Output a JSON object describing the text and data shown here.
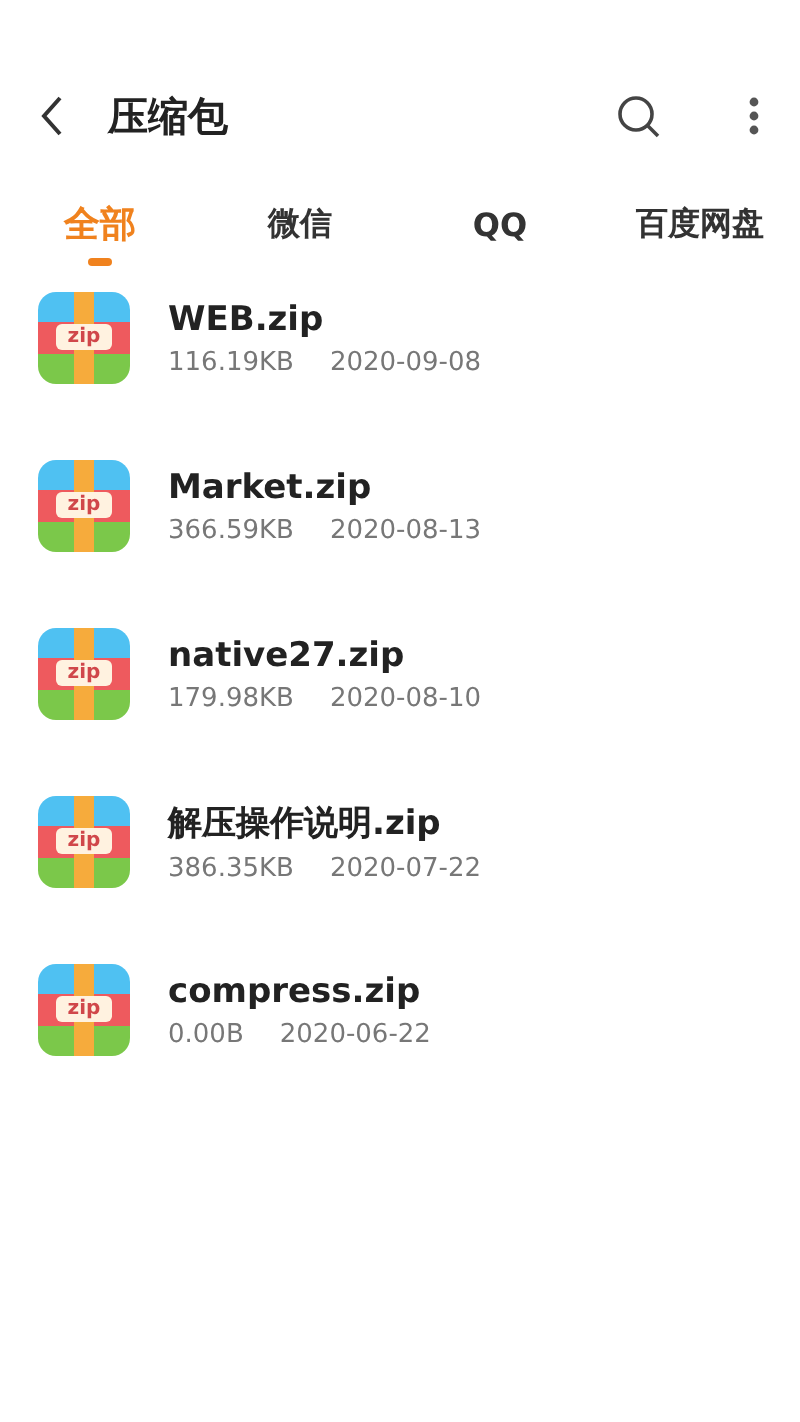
{
  "header": {
    "title": "压缩包"
  },
  "tabs": [
    {
      "label": "全部",
      "selected": true
    },
    {
      "label": "微信",
      "selected": false
    },
    {
      "label": "QQ",
      "selected": false
    },
    {
      "label": "百度网盘",
      "selected": false
    }
  ],
  "files": [
    {
      "name": "WEB.zip",
      "size": "116.19KB",
      "date": "2020-09-08",
      "icon_label": "zip"
    },
    {
      "name": "Market.zip",
      "size": "366.59KB",
      "date": "2020-08-13",
      "icon_label": "zip"
    },
    {
      "name": "native27.zip",
      "size": "179.98KB",
      "date": "2020-08-10",
      "icon_label": "zip"
    },
    {
      "name": "解压操作说明.zip",
      "size": "386.35KB",
      "date": "2020-07-22",
      "icon_label": "zip"
    },
    {
      "name": "compress.zip",
      "size": "0.00B",
      "date": "2020-06-22",
      "icon_label": "zip"
    }
  ]
}
